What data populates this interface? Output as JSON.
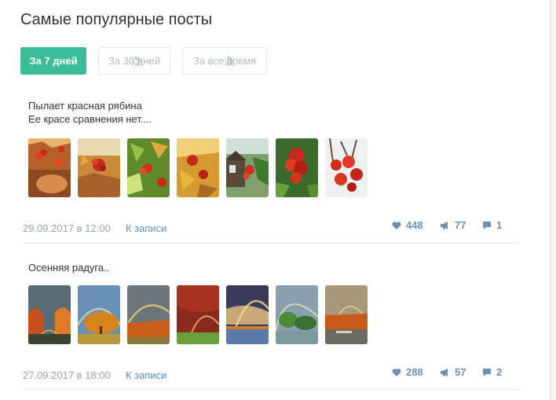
{
  "page": {
    "title": "Самые популярные посты"
  },
  "tabs": [
    {
      "label": "За 7 дней",
      "active": true
    },
    {
      "label": "За 30 дней",
      "active": false,
      "loading": true
    },
    {
      "label": "За все время",
      "active": false,
      "loading": true
    }
  ],
  "posts": [
    {
      "text_line1": "Пылает красная рябина",
      "text_line2": "Ее красе сравнения нет....",
      "images": [
        "rowan-photo-1",
        "rowan-photo-2",
        "rowan-photo-3",
        "rowan-photo-4",
        "rowan-photo-5",
        "rowan-photo-6",
        "rowan-photo-7"
      ],
      "date": "29.09.2017 в 12:00",
      "link_label": "К записи",
      "likes": "448",
      "reposts": "77",
      "comments": "1"
    },
    {
      "text_line1": "Осенняя радуга..",
      "images": [
        "rainbow-photo-1",
        "rainbow-photo-2",
        "rainbow-photo-3",
        "rainbow-photo-4",
        "rainbow-photo-5",
        "rainbow-photo-6",
        "rainbow-photo-7"
      ],
      "date": "27.09.2017 в 18:00",
      "link_label": "К записи",
      "likes": "288",
      "reposts": "57",
      "comments": "2"
    }
  ],
  "icons": {
    "likes": "heart-icon",
    "reposts": "megaphone-icon",
    "comments": "comment-icon",
    "loading": "spinner-icon"
  },
  "colors": {
    "accent": "#3bbd97",
    "link": "#5d8fbf",
    "stat": "#6f8fb5",
    "muted": "#9aa3ad"
  }
}
